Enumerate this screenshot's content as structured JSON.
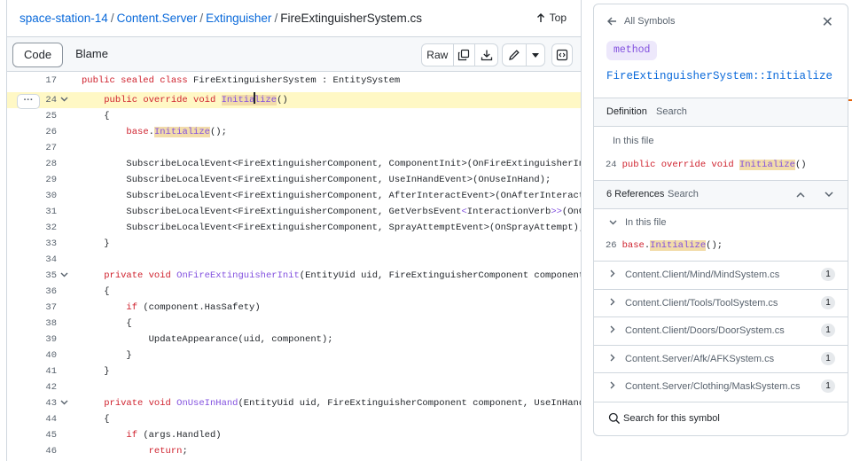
{
  "breadcrumb": {
    "repo": "space-station-14",
    "dir1": "Content.Server",
    "dir2": "Extinguisher",
    "file": "FireExtinguisherSystem.cs",
    "sep": "/"
  },
  "top_link": "Top",
  "toolbar": {
    "code": "Code",
    "blame": "Blame",
    "raw": "Raw"
  },
  "code_lines": [
    {
      "n": "17",
      "html": "<span class=\"k\">public sealed class</span> FireExtinguisherSystem : EntitySystem"
    },
    {
      "n": "24",
      "html": "    <span class=\"k\">public override void</span> <span class=\"m fn\">Initia<i class=\"cursor\"></i>lize</span>()",
      "hl": true,
      "chev": true
    },
    {
      "n": "25",
      "html": "    {"
    },
    {
      "n": "26",
      "html": "        <span class=\"k\">base</span>.<span class=\"m fn\">Initialize</span>();"
    },
    {
      "n": "27",
      "html": ""
    },
    {
      "n": "28",
      "html": "        SubscribeLocalEvent&lt;FireExtinguisherComponent, ComponentInit&gt;(OnFireExtinguisherInit);"
    },
    {
      "n": "29",
      "html": "        SubscribeLocalEvent&lt;FireExtinguisherComponent, UseInHandEvent&gt;(OnUseInHand);"
    },
    {
      "n": "30",
      "html": "        SubscribeLocalEvent&lt;FireExtinguisherComponent, AfterInteractEvent&gt;(OnAfterInteract);"
    },
    {
      "n": "31",
      "html": "        SubscribeLocalEvent&lt;FireExtinguisherComponent, GetVerbsEvent<span class=\"fn\">&lt;</span>InteractionVerb<span class=\"fn\">&gt;&gt;</span>(OnGetInt"
    },
    {
      "n": "32",
      "html": "        SubscribeLocalEvent&lt;FireExtinguisherComponent, SprayAttemptEvent&gt;(OnSprayAttempt);"
    },
    {
      "n": "33",
      "html": "    }"
    },
    {
      "n": "34",
      "html": ""
    },
    {
      "n": "35",
      "html": "    <span class=\"k\">private void</span> <span class=\"fn\">OnFireExtinguisherInit</span>(EntityUid uid, FireExtinguisherComponent component, Com",
      "chev": true
    },
    {
      "n": "36",
      "html": "    {"
    },
    {
      "n": "37",
      "html": "        <span class=\"k\">if</span> (component.HasSafety)"
    },
    {
      "n": "38",
      "html": "        {"
    },
    {
      "n": "39",
      "html": "            UpdateAppearance(uid, component);"
    },
    {
      "n": "40",
      "html": "        }"
    },
    {
      "n": "41",
      "html": "    }"
    },
    {
      "n": "42",
      "html": ""
    },
    {
      "n": "43",
      "html": "    <span class=\"k\">private void</span> <span class=\"fn\">OnUseInHand</span>(EntityUid uid, FireExtinguisherComponent component, UseInHandEvent",
      "chev": true
    },
    {
      "n": "44",
      "html": "    {"
    },
    {
      "n": "45",
      "html": "        <span class=\"k\">if</span> (args.Handled)"
    },
    {
      "n": "46",
      "html": "            <span class=\"k\">return</span>;"
    }
  ],
  "panel": {
    "back_label": "All Symbols",
    "kind": "method",
    "symbol": "FireExtinguisherSystem::Initialize",
    "definition": {
      "title": "Definition",
      "search": "Search",
      "in_file": "In this file",
      "line_no": "24"
    },
    "references": {
      "title": "6 References",
      "search": "Search",
      "in_file": "In this file",
      "line_no": "26"
    },
    "files": [
      {
        "path": "Content.Client/Mind/MindSystem.cs",
        "count": "1"
      },
      {
        "path": "Content.Client/Tools/ToolSystem.cs",
        "count": "1"
      },
      {
        "path": "Content.Client/Doors/DoorSystem.cs",
        "count": "1"
      },
      {
        "path": "Content.Server/Afk/AFKSystem.cs",
        "count": "1"
      },
      {
        "path": "Content.Server/Clothing/MaskSystem.cs",
        "count": "1"
      }
    ],
    "search_symbol": "Search for this symbol"
  }
}
